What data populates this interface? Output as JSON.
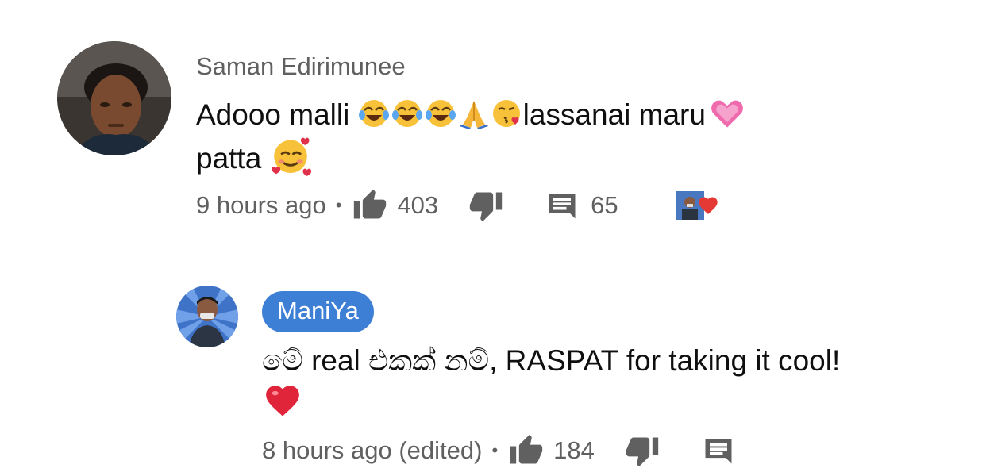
{
  "comments": [
    {
      "author": "Saman Edirimunee",
      "text_part1": "Adooo malli ",
      "text_part2": "lassanai maru",
      "text_line2": "patta ",
      "time": "9 hours ago",
      "separator": "•",
      "likes": "403",
      "replies": "65"
    },
    {
      "author": "ManiYa",
      "text": "මේ real එකක් නම්, RASPAT for taking it cool!",
      "time": "8 hours ago (edited)",
      "separator": "•",
      "likes": "184"
    }
  ],
  "icons": {
    "like": "thumbs-up-icon",
    "dislike": "thumbs-down-icon",
    "reply": "comment-icon",
    "heart": "heart-icon"
  },
  "colors": {
    "chip": "#3e7fd6",
    "meta": "#606060",
    "text": "#0f0f0f",
    "heart": "#e53935"
  }
}
